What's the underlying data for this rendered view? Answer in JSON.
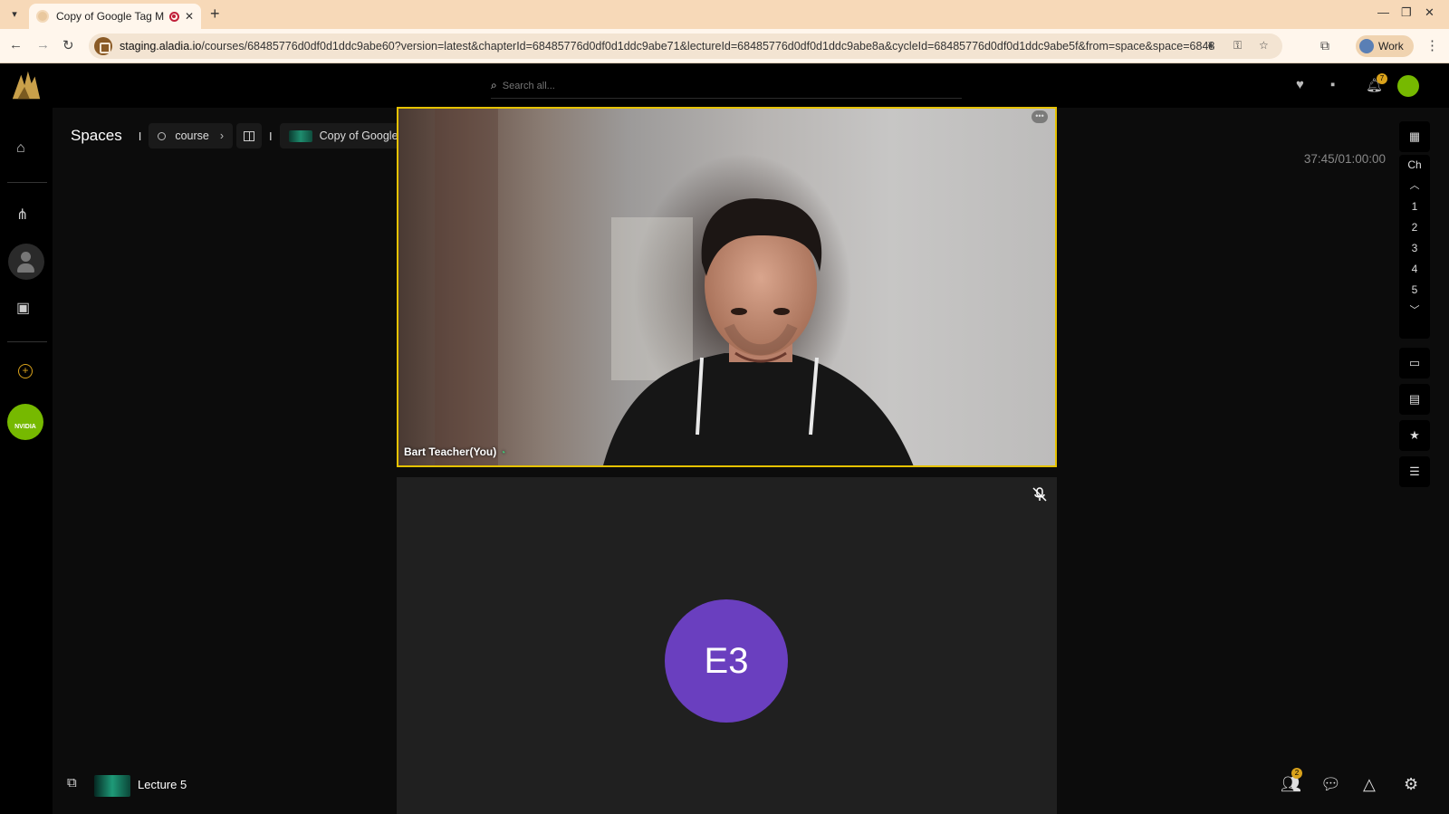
{
  "browser": {
    "tab_title": "Copy of Google Tag Man",
    "new_tab": "+",
    "url_host": "staging.aladia.io",
    "url_path": "/courses/68485776d0df0d1ddc9abe60?version=latest&chapterId=68485776d0df0d1ddc9abe71&lectureId=68485776d0df0d1ddc9abe8a&cycleId=68485776d0df0d1ddc9abe5f&from=space&space=6848...",
    "profile_label": "Work"
  },
  "header": {
    "search_placeholder": "Search all...",
    "notification_count": "7"
  },
  "sidebar": {
    "nvidia_label": "NVIDIA"
  },
  "breadcrumb": {
    "root": "Spaces",
    "separator": "I",
    "course": "course",
    "lecture_title": "Copy of Google Ta..."
  },
  "timer": "37:45/01:00:00",
  "video": {
    "main_participant": "Bart Teacher(You)",
    "second_participant_initials": "E3"
  },
  "right_rail": {
    "chapter_label": "Ch",
    "chapters": [
      "1",
      "2",
      "3",
      "4",
      "5"
    ]
  },
  "bottom": {
    "lecture_label": "Lecture 5",
    "participants_count": "2"
  },
  "colors": {
    "accent_gold": "#d9a21b",
    "active_speaker_border": "#e6c200",
    "avatar_purple": "#6a3fbf",
    "nvidia_green": "#76b900"
  }
}
